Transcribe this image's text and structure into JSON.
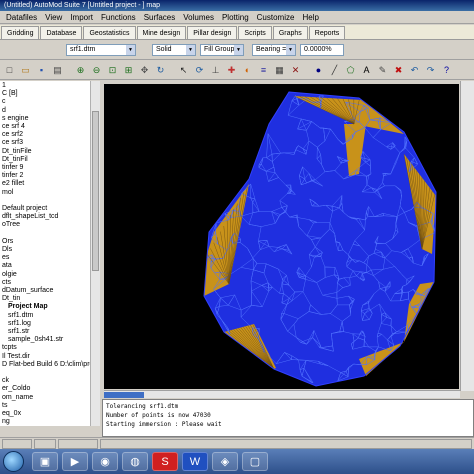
{
  "window": {
    "title": "(Untitled) AutoMod Suite 7 [Untitled project - ] map"
  },
  "menu": [
    "Datafiles",
    "View",
    "Import",
    "Functions",
    "Surfaces",
    "Volumes",
    "Plotting",
    "Customize",
    "Help"
  ],
  "tabs": [
    "Gridding",
    "Database",
    "Geostatistics",
    "Mine design",
    "Pillar design",
    "Scripts",
    "Graphs",
    "Reports"
  ],
  "combos": {
    "layer": "srf1.dtm",
    "color": "Solid",
    "style": "Fill Group",
    "scale": "Bearing = 0",
    "zoom": "0.0000%"
  },
  "toolbar_icons": [
    "new-icon",
    "open-icon",
    "save-icon",
    "print-icon",
    "zoom-in-icon",
    "zoom-out-icon",
    "zoom-window-icon",
    "zoom-extents-icon",
    "pan-icon",
    "refresh-icon",
    "select-icon",
    "rotate-icon",
    "measure-icon",
    "pick-icon",
    "color-icon",
    "layers-icon",
    "grid-icon",
    "marker-icon",
    "point-icon",
    "line-icon",
    "polygon-icon",
    "text-icon",
    "edit-icon",
    "delete-icon",
    "undo-icon",
    "redo-icon",
    "help-icon"
  ],
  "tree": [
    {
      "label": "1",
      "bold": false
    },
    {
      "label": "C [B]",
      "bold": false
    },
    {
      "label": "c",
      "bold": false
    },
    {
      "label": "d",
      "bold": false
    },
    {
      "label": "s engine",
      "bold": false
    },
    {
      "label": "ce srf 4",
      "bold": false
    },
    {
      "label": "ce srf2",
      "bold": false
    },
    {
      "label": "ce srf3",
      "bold": false
    },
    {
      "label": "Dt_tinFile",
      "bold": false
    },
    {
      "label": "Dt_tinFil",
      "bold": false
    },
    {
      "label": "tinfer 9",
      "bold": false
    },
    {
      "label": "tinfer 2",
      "bold": false
    },
    {
      "label": "e2 fillet",
      "bold": false
    },
    {
      "label": "mol",
      "bold": false
    },
    {
      "label": "",
      "bold": false
    },
    {
      "label": "Default project",
      "bold": false
    },
    {
      "label": "dflt_shapeList_tcd",
      "bold": false
    },
    {
      "label": "oTree",
      "bold": false
    },
    {
      "label": "",
      "bold": false
    },
    {
      "label": "Ors",
      "bold": false
    },
    {
      "label": "Dls",
      "bold": false
    },
    {
      "label": "es",
      "bold": false
    },
    {
      "label": "ata",
      "bold": false
    },
    {
      "label": "olgie",
      "bold": false
    },
    {
      "label": "cts",
      "bold": false
    },
    {
      "label": "dDatum_surface",
      "bold": false
    },
    {
      "label": "Dt_tin",
      "bold": false
    },
    {
      "label": "Project Map",
      "bold": true
    },
    {
      "label": "srf1.dtm",
      "bold": false
    },
    {
      "label": "srf1.log",
      "bold": false
    },
    {
      "label": "srf1.str",
      "bold": false
    },
    {
      "label": "sample_0sh41.str",
      "bold": false
    },
    {
      "label": "tcpts",
      "bold": false
    },
    {
      "label": "Il Test.dir",
      "bold": false
    },
    {
      "label": "D Flat-bed Build 6 D:\\clim\\pro",
      "bold": false
    },
    {
      "label": "",
      "bold": false
    },
    {
      "label": "ck",
      "bold": false
    },
    {
      "label": "er_Coldo",
      "bold": false
    },
    {
      "label": "om_name",
      "bold": false
    },
    {
      "label": "ts",
      "bold": false
    },
    {
      "label": "eq_0x",
      "bold": false
    },
    {
      "label": "ng",
      "bold": false
    }
  ],
  "console": [
    "Tolerancing srf1.dtm",
    "Number of points is now 47030",
    "Starting immersion : Please wait"
  ],
  "statusbar": [
    "",
    "",
    "",
    ""
  ],
  "colors": {
    "viewport_bg": "#000000",
    "mesh_fill": "#1f2fe0",
    "mesh_lines": "#5070ff",
    "edge_fill": "#c8921a"
  },
  "taskbar": {
    "buttons": [
      "start-icon",
      "explorer-icon",
      "media-icon",
      "media-player-icon",
      "browser-icon",
      "surpac-icon",
      "word-icon",
      "app-icon",
      "window-icon"
    ]
  }
}
